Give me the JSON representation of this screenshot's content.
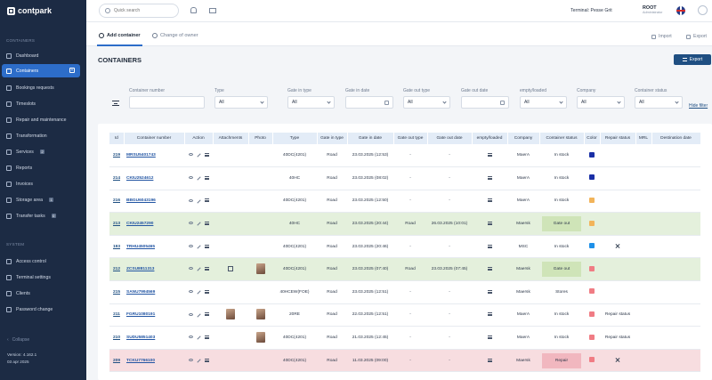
{
  "sidebar": {
    "logo": "contpark",
    "section_main": "CONTAINERS",
    "items": [
      {
        "label": "Dashboard"
      },
      {
        "label": "Containers"
      },
      {
        "label": "Bookings requests"
      },
      {
        "label": "Timeslots"
      },
      {
        "label": "Repair and maintenance"
      },
      {
        "label": "Transformation"
      },
      {
        "label": "Services",
        "badge": "2"
      },
      {
        "label": "Reports"
      },
      {
        "label": "Invoices"
      },
      {
        "label": "Storage area",
        "badge": "1"
      },
      {
        "label": "Transfer tasks",
        "badge": "0"
      }
    ],
    "section_system": "SYSTEM",
    "system_items": [
      {
        "label": "Access control"
      },
      {
        "label": "Terminal settings"
      },
      {
        "label": "Clients"
      },
      {
        "label": "Password change"
      }
    ],
    "collapse_label": "Collapse",
    "version_line1": "Version: 4.162.1",
    "version_line2": "03 apr 2025"
  },
  "header": {
    "search_placeholder": "Quick search",
    "location": "Terminal: Pesse Grit",
    "user_name": "ROOT",
    "user_role": "Administrator"
  },
  "tabs": {
    "add_container": "Add container",
    "change_owner": "Change of owner",
    "import": "Import",
    "export": "Export"
  },
  "page": {
    "title": "CONTAINERS",
    "export_button": "Export"
  },
  "filters": [
    {
      "label": "Container number",
      "value": ""
    },
    {
      "label": "Type",
      "value": "All"
    },
    {
      "label": "Gate in type",
      "value": "All"
    },
    {
      "label": "Gate in date",
      "value": ""
    },
    {
      "label": "Gate out type",
      "value": "All"
    },
    {
      "label": "Gate out date",
      "value": ""
    },
    {
      "label": "empty/loaded",
      "value": "All"
    },
    {
      "label": "Company",
      "value": "All"
    },
    {
      "label": "Container status",
      "value": "All"
    }
  ],
  "hide_filter": "Hide filter",
  "table": {
    "headers": [
      "Id",
      "Container number",
      "Action",
      "Attachments",
      "Photo",
      "Type",
      "Gate in type",
      "Gate in date",
      "Gate out type",
      "Gate out date",
      "empty/loaded",
      "Company",
      "Container status",
      "Color",
      "Repair status",
      "MRL",
      "Destination date"
    ],
    "rows": [
      {
        "id": "219",
        "number": "MRSU5401743",
        "type": "40DC(4201)",
        "gate_in_type": "Road",
        "gate_in_date": "23.03.2025 (12:53)",
        "gate_out_type": "-",
        "gate_out_date": "-",
        "company": "MaerA",
        "status": "In stock",
        "color": "navy",
        "repair": "",
        "row_style": ""
      },
      {
        "id": "214",
        "number": "CKIU2524612",
        "type": "40HC",
        "gate_in_type": "Road",
        "gate_in_date": "23.03.2025 (08:02)",
        "gate_out_type": "-",
        "gate_out_date": "-",
        "company": "MaerA",
        "status": "In stock",
        "color": "navy",
        "repair": "",
        "row_style": ""
      },
      {
        "id": "216",
        "number": "BBGU6043196",
        "type": "40DC(4201)",
        "gate_in_type": "Road",
        "gate_in_date": "23.03.2025 (12:50)",
        "gate_out_type": "-",
        "gate_out_date": "-",
        "company": "MaerA",
        "status": "In stock",
        "color": "orange",
        "repair": "",
        "row_style": ""
      },
      {
        "id": "213",
        "number": "CKIU2457290",
        "type": "40HC",
        "gate_in_type": "Road",
        "gate_in_date": "23.03.2025 (20:44)",
        "gate_out_type": "Road",
        "gate_out_date": "26.03.2025 (10:01)",
        "company": "Maersk",
        "status": "Gate out",
        "color": "orange",
        "repair": "",
        "row_style": "green"
      },
      {
        "id": "193",
        "number": "TRHU4505465",
        "type": "40DC(4201)",
        "gate_in_type": "Road",
        "gate_in_date": "23.03.2025 (20:46)",
        "gate_out_type": "-",
        "gate_out_date": "-",
        "company": "MSC",
        "status": "In stock",
        "color": "cyan",
        "repair": "tool",
        "row_style": ""
      },
      {
        "id": "212",
        "number": "ZCSU8811313",
        "type": "40DC(4201)",
        "gate_in_type": "Road",
        "gate_in_date": "23.03.2025 (07:40)",
        "gate_out_type": "Road",
        "gate_out_date": "23.03.2025 (07:45)",
        "company": "Maersk",
        "status": "Gate out",
        "color": "pink",
        "repair": "",
        "row_style": "green"
      },
      {
        "id": "215",
        "number": "SANU7994569",
        "type": "40HCEW(FOE)",
        "gate_in_type": "Road",
        "gate_in_date": "23.03.2025 (12:51)",
        "gate_out_type": "-",
        "gate_out_date": "-",
        "company": "Maersk",
        "status": "Stores",
        "color": "pink",
        "repair": "",
        "row_style": ""
      },
      {
        "id": "211",
        "number": "FGRU1080191",
        "type": "20RE",
        "gate_in_type": "Road",
        "gate_in_date": "22.03.2025 (12:51)",
        "gate_out_type": "-",
        "gate_out_date": "-",
        "company": "MaerA",
        "status": "In stock",
        "color": "pink",
        "repair": "Repair status",
        "row_style": ""
      },
      {
        "id": "210",
        "number": "SUDU5851403",
        "type": "40DC(4201)",
        "gate_in_type": "Road",
        "gate_in_date": "21.03.2025 (12:45)",
        "gate_out_type": "-",
        "gate_out_date": "-",
        "company": "MaerA",
        "status": "In stock",
        "color": "pink",
        "repair": "Repair status",
        "row_style": ""
      },
      {
        "id": "209",
        "number": "TCKU7766100",
        "type": "40DC(4201)",
        "gate_in_type": "Road",
        "gate_in_date": "11.03.2025 (09:00)",
        "gate_out_type": "-",
        "gate_out_date": "-",
        "company": "Maersk",
        "status": "Repair",
        "color": "pink",
        "repair": "tool",
        "row_style": "red"
      }
    ]
  },
  "colors": {
    "sidebar_bg": "#1c2b44",
    "accent": "#2d6dc9",
    "export_button": "#1f4f82"
  }
}
